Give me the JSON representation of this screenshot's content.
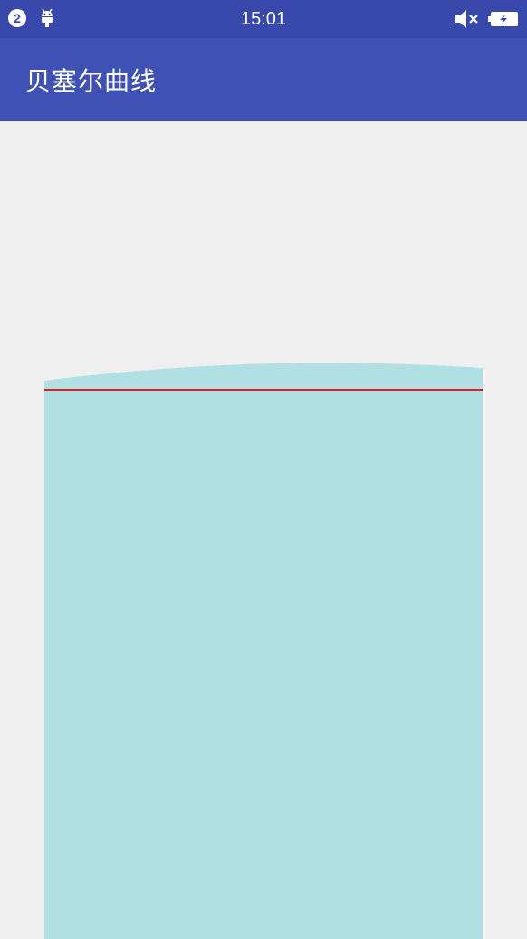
{
  "status_bar": {
    "notification_count": "2",
    "time": "15:01",
    "icons": [
      "android-debug-icon",
      "mute-icon",
      "battery-icon"
    ]
  },
  "app_bar": {
    "title": "贝塞尔曲线"
  },
  "colors": {
    "status_bar": "#3949ab",
    "app_bar": "#3f51b5",
    "background": "#efefef",
    "fill": "#b0e0e3",
    "line": "#e51c23"
  }
}
